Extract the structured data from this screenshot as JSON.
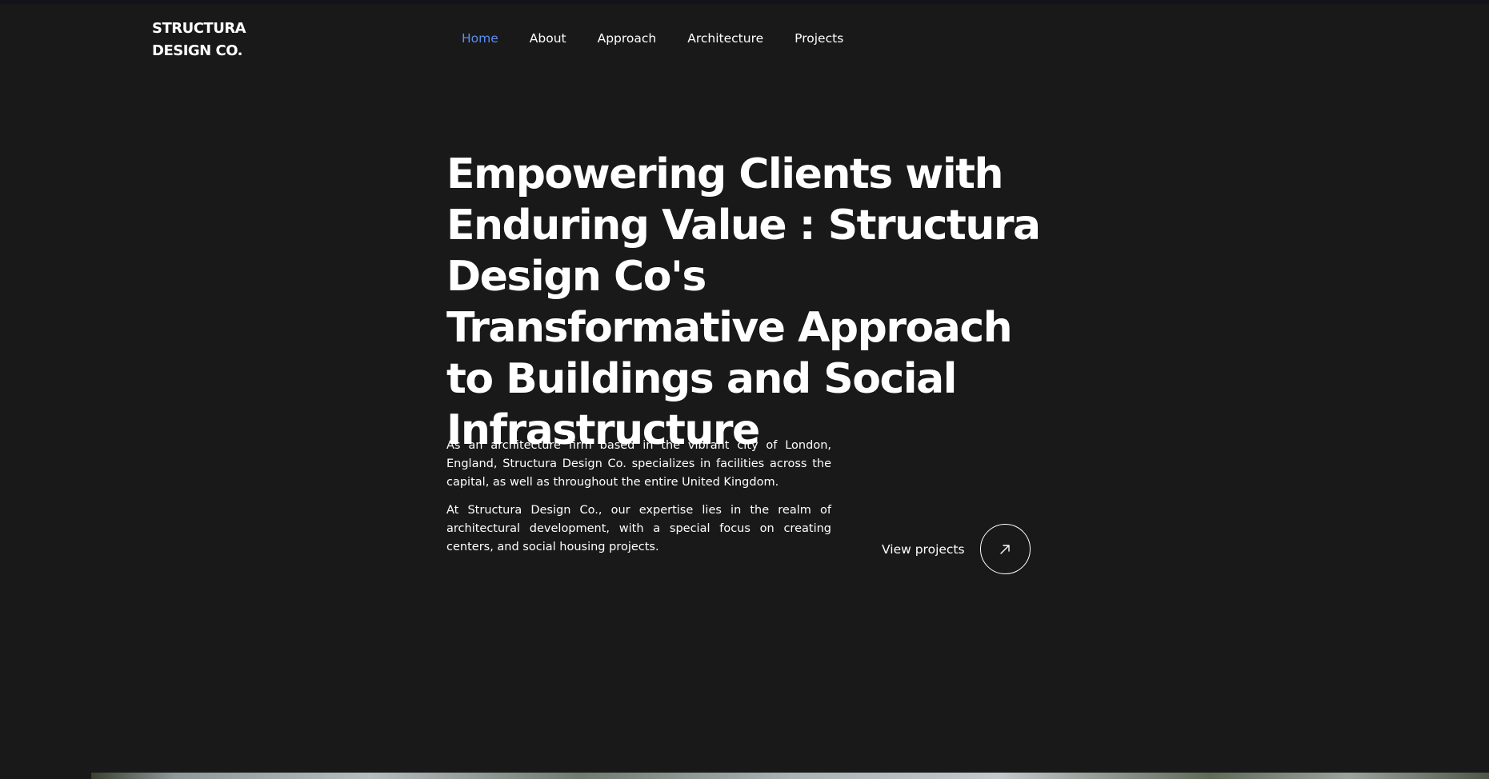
{
  "brand": {
    "line1": "STRUCTURA",
    "line2": "DESIGN CO."
  },
  "nav": {
    "items": [
      {
        "label": "Home",
        "active": true
      },
      {
        "label": "About"
      },
      {
        "label": "Approach"
      },
      {
        "label": "Architecture"
      },
      {
        "label": "Projects"
      }
    ]
  },
  "hero": {
    "headline": "Empowering Clients with Enduring Value : Structura Design Co's Transformative Approach to Buildings and Social Infrastructure",
    "paragraph1": "As an architecture firm based in the vibrant city of London, England, Structura Design Co. specializes in facilities across the capital, as well as throughout the entire United Kingdom.",
    "paragraph2": "At Structura Design Co., our expertise lies in the realm of architectural development, with a special focus on creating centers, and social housing projects.",
    "cta_label": "View projects",
    "cta_icon": "arrow-up-right-icon"
  },
  "colors": {
    "background": "#191919",
    "text": "#ffffff",
    "nav_active": "#5b8ff0"
  }
}
